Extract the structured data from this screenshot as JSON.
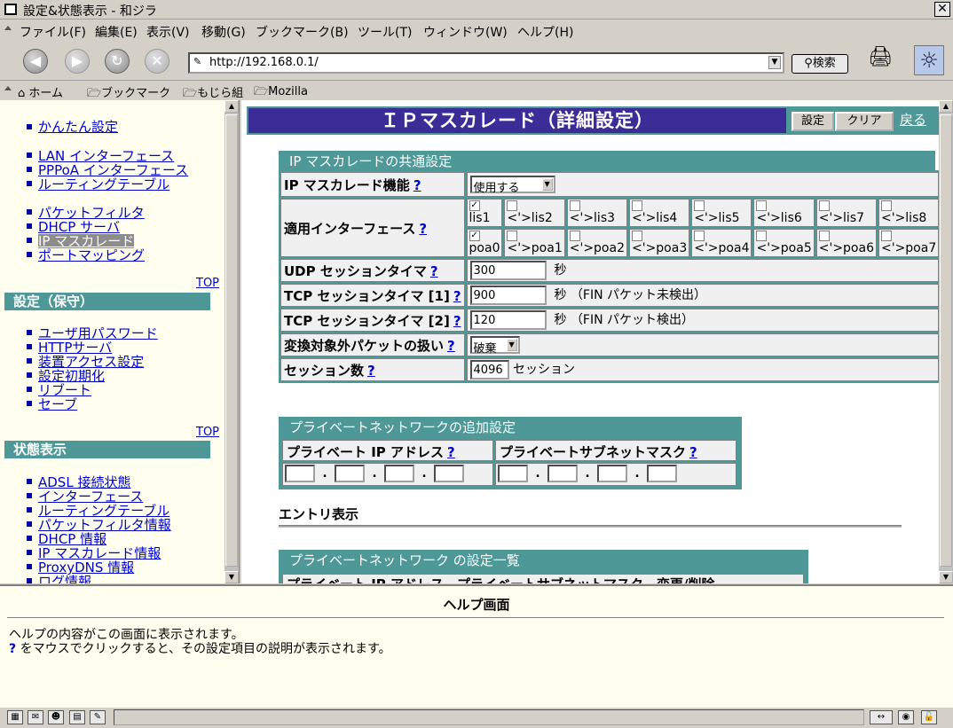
{
  "window": {
    "title": "設定&状態表示 - 和ジラ",
    "close_glyph": "✕"
  },
  "menu": [
    "ファイル(F)",
    "編集(E)",
    "表示(V)",
    "移動(G)",
    "ブックマーク(B)",
    "ツール(T)",
    "ウィンドウ(W)",
    "ヘルプ(H)"
  ],
  "nav": {
    "url": "http://192.168.0.1/",
    "search_label": "検索"
  },
  "personal_toolbar": [
    "ホーム",
    "ブックマーク",
    "もじら組",
    "Mozilla"
  ],
  "sidebar": {
    "group1": [
      "かんたん設定"
    ],
    "group2": [
      "LAN インターフェース",
      "PPPoA インターフェース",
      "ルーティングテーブル"
    ],
    "group3": [
      "パケットフィルタ",
      "DHCP サーバ",
      "IP マスカレード",
      "ポートマッピング"
    ],
    "top_label": "TOP",
    "section_maint": "設定（保守）",
    "group4": [
      "ユーザ用パスワード",
      "HTTPサーバ",
      "装置アクセス設定",
      "設定初期化",
      "リブート",
      "セーブ"
    ],
    "section_status": "状態表示",
    "group5": [
      "ADSL 接続状態",
      "インターフェース",
      "ルーティングテーブル",
      "パケットフィルタ情報",
      "DHCP 情報",
      "IP マスカレード情報",
      "ProxyDNS 情報",
      "ログ情報"
    ]
  },
  "page": {
    "title": "ＩＰマスカレード（詳細設定）",
    "btn_set": "設定",
    "btn_clear": "クリア",
    "back": "戻る",
    "help_mark": "?",
    "common": {
      "caption": "IP マスカレードの共通設定",
      "func_label": "IP マスカレード機能",
      "func_value": "使用する",
      "iface_label": "適用インターフェース",
      "lis": [
        {
          "label": "lis1",
          "checked": true
        },
        {
          "label": "<'>lis2",
          "checked": false
        },
        {
          "label": "<'>lis3",
          "checked": false
        },
        {
          "label": "<'>lis4",
          "checked": false
        },
        {
          "label": "<'>lis5",
          "checked": false
        },
        {
          "label": "<'>lis6",
          "checked": false
        },
        {
          "label": "<'>lis7",
          "checked": false
        },
        {
          "label": "<'>lis8",
          "checked": false
        }
      ],
      "poa": [
        {
          "label": "poa0",
          "checked": true
        },
        {
          "label": "<'>poa1",
          "checked": false
        },
        {
          "label": "<'>poa2",
          "checked": false
        },
        {
          "label": "<'>poa3",
          "checked": false
        },
        {
          "label": "<'>poa4",
          "checked": false
        },
        {
          "label": "<'>poa5",
          "checked": false
        },
        {
          "label": "<'>poa6",
          "checked": false
        },
        {
          "label": "<'>poa7",
          "checked": false
        }
      ],
      "udp_label": "UDP セッションタイマ",
      "udp_value": "300",
      "sec": "秒",
      "tcp1_label": "TCP セッションタイマ [1]",
      "tcp1_value": "900",
      "tcp1_note": "秒 （FIN パケット未検出）",
      "tcp2_label": "TCP セッションタイマ [2]",
      "tcp2_value": "120",
      "tcp2_note": "秒 （FIN パケット検出）",
      "excl_label": "変換対象外パケットの扱い",
      "excl_value": "破棄",
      "sess_label": "セッション数",
      "sess_value": "4096",
      "sess_unit": "セッション"
    },
    "private": {
      "caption": "プライベートネットワークの追加設定",
      "ip_label": "プライベート IP アドレス",
      "mask_label": "プライベートサブネットマスク",
      "dot": "."
    },
    "entry_heading": "エントリ表示",
    "list_caption": "プライベートネットワーク の設定一覧",
    "list_partial": "プライベート IP アドレス　プライベートサブネットマスク　変更/削除"
  },
  "help": {
    "title": "ヘルプ画面",
    "line1": "ヘルプの内容がこの画面に表示されます。",
    "line2_mark": "?",
    "line2": " をマウスでクリックすると、その設定項目の説明が表示されます。"
  }
}
